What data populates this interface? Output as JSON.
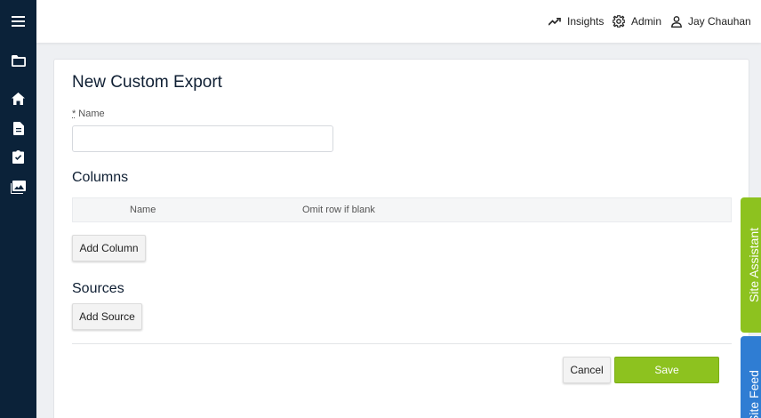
{
  "topbar": {
    "insights_label": "Insights",
    "admin_label": "Admin",
    "user_name": "Jay Chauhan"
  },
  "sidebar": {
    "icons": [
      "menu-icon",
      "folder-icon",
      "home-icon",
      "document-icon",
      "checklist-icon",
      "gallery-icon"
    ]
  },
  "form": {
    "title": "New Custom Export",
    "required_marker": "*",
    "name_label": "Name",
    "name_value": "",
    "columns_title": "Columns",
    "columns_headers": [
      "Name",
      "Omit row if blank"
    ],
    "add_column_label": "Add Column",
    "sources_title": "Sources",
    "add_source_label": "Add Source",
    "cancel_label": "Cancel",
    "save_label": "Save"
  },
  "side_tabs": {
    "assistant_label": "Site Assistant",
    "feed_label": "Site Feed"
  },
  "colors": {
    "sidebar": "#0b2239",
    "accent_green": "#8dc21f",
    "feed_blue": "#2f7dd3"
  }
}
